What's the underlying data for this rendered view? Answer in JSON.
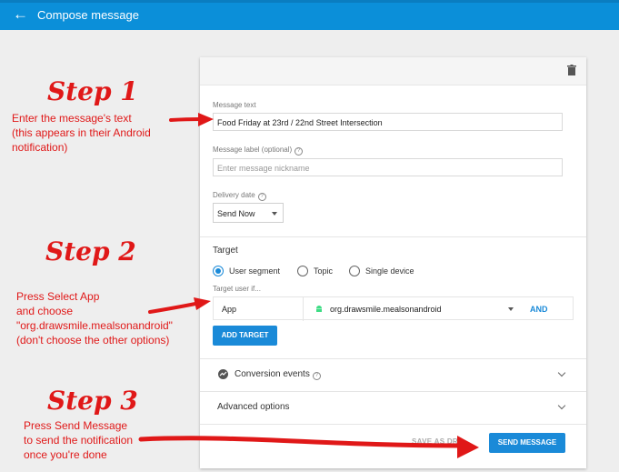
{
  "header": {
    "back_icon": "arrow-back-icon",
    "title": "Compose message",
    "color": "#0b8fd9"
  },
  "card": {
    "delete_icon": "trash-icon",
    "message_text": {
      "label": "Message text",
      "value": "Food Friday at 23rd / 22nd Street Intersection"
    },
    "message_label": {
      "label": "Message label (optional)",
      "placeholder": "Enter message nickname"
    },
    "delivery": {
      "label": "Delivery date",
      "value": "Send Now"
    },
    "target": {
      "title": "Target",
      "options": [
        "User segment",
        "Topic",
        "Single device"
      ],
      "selected": "User segment",
      "target_user_if": "Target user if...",
      "field": "App",
      "app_value": "org.drawsmile.mealsonandroid",
      "and_label": "AND",
      "add_target_label": "ADD TARGET"
    },
    "conversion_events": "Conversion events",
    "advanced_options": "Advanced options",
    "save_draft_label": "SAVE AS DR",
    "send_label": "SEND MESSAGE",
    "accent_color": "#1a8ad8"
  },
  "annotations": {
    "step1": "Step 1",
    "step1_lines": [
      "Enter the message's text",
      "(this appears in their Android",
      "notification)"
    ],
    "step2": "Step 2",
    "step2_lines": [
      "Press Select App",
      "and choose",
      "\"org.drawsmile.mealsonandroid\"",
      "(don't choose the other options)"
    ],
    "step3": "Step 3",
    "step3_lines": [
      "Press Send Message",
      "to send the notification",
      "once you're done"
    ],
    "color": "#e01818"
  }
}
